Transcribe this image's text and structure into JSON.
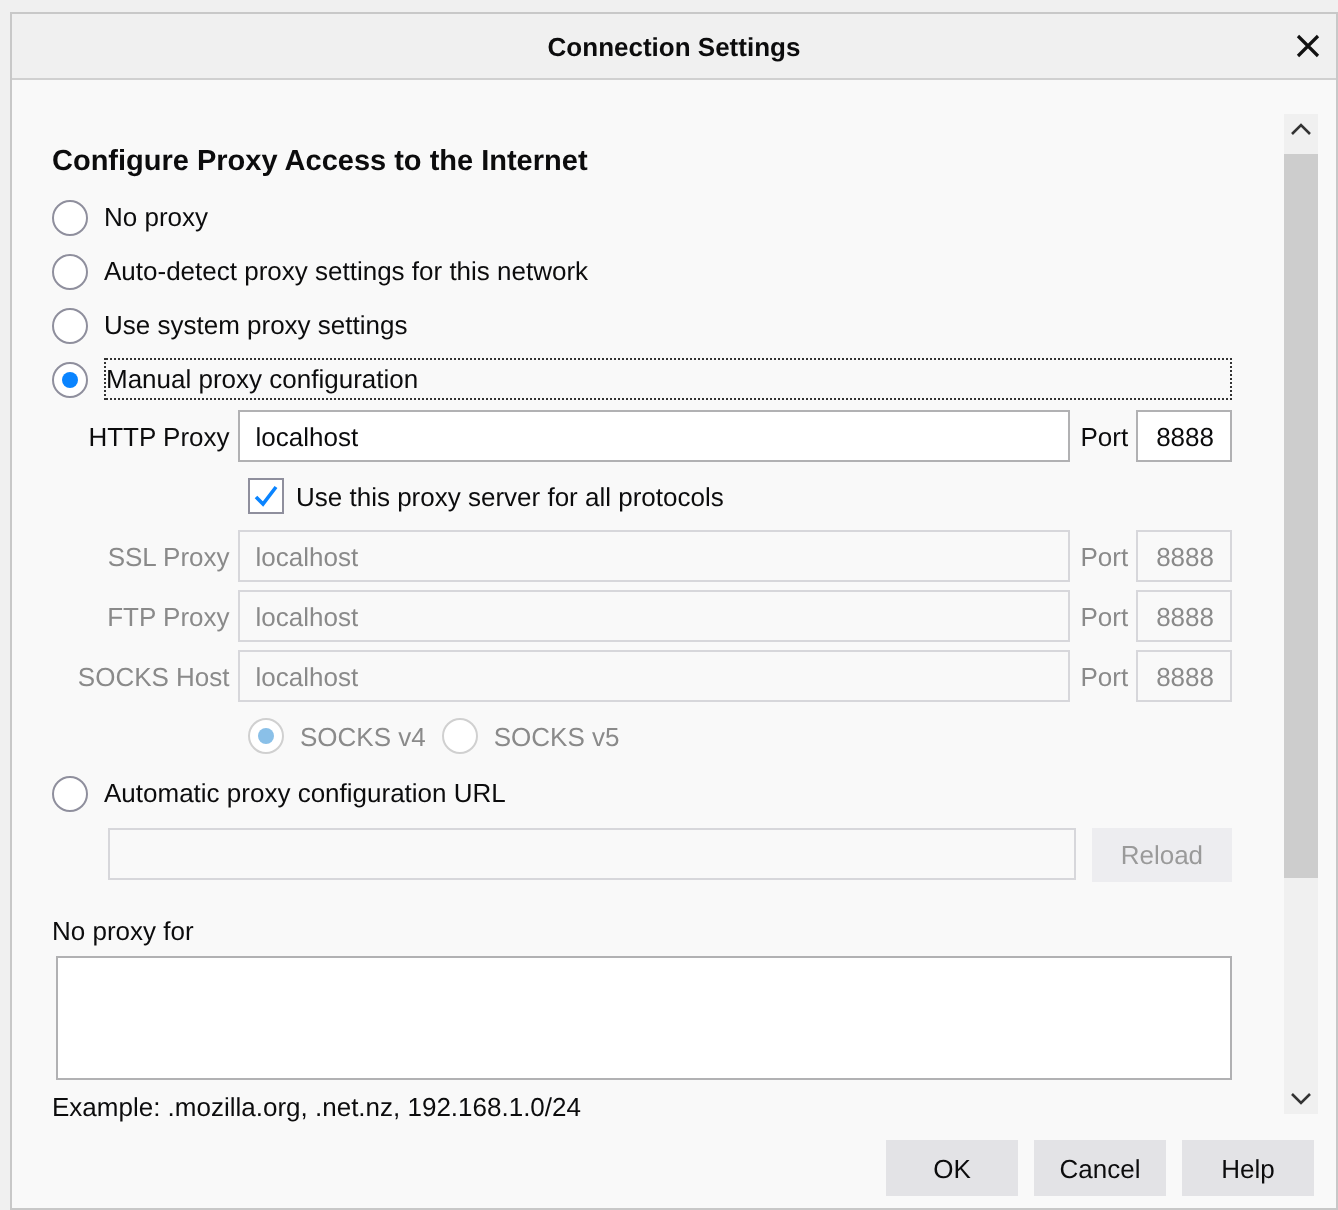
{
  "dialog": {
    "title": "Connection Settings"
  },
  "heading": "Configure Proxy Access to the Internet",
  "modes": [
    {
      "kind": "plain",
      "label": "No proxy",
      "selected": false
    },
    {
      "kind": "plain",
      "label": "Auto-detect proxy settings for this network",
      "selected": false
    },
    {
      "kind": "plain",
      "label": "Use system proxy settings",
      "selected": false
    },
    {
      "kind": "manual",
      "label": "Manual proxy configuration",
      "selected": true
    },
    {
      "kind": "auto_url",
      "label": "Automatic proxy configuration URL",
      "selected": false
    }
  ],
  "proxies": [
    {
      "label": "HTTP Proxy",
      "value": "localhost",
      "port_label": "Port",
      "port": "8888",
      "disabled": false
    },
    {
      "label": "SSL Proxy",
      "value": "localhost",
      "port_label": "Port",
      "port": "8888",
      "disabled": true
    },
    {
      "label": "FTP Proxy",
      "value": "localhost",
      "port_label": "Port",
      "port": "8888",
      "disabled": true
    },
    {
      "label": "SOCKS Host",
      "value": "localhost",
      "port_label": "Port",
      "port": "8888",
      "disabled": true
    }
  ],
  "share": {
    "label": "Use this proxy server for all protocols",
    "checked": true
  },
  "socks_versions": [
    {
      "label": "SOCKS v4",
      "selected": true
    },
    {
      "label": "SOCKS v5",
      "selected": false
    }
  ],
  "reload": {
    "label": "Reload",
    "disabled": true
  },
  "no_proxy": {
    "label": "No proxy for",
    "example": "Example: .mozilla.org, .net.nz, 192.168.1.0/24"
  },
  "buttons": [
    "OK",
    "Cancel",
    "Help"
  ]
}
